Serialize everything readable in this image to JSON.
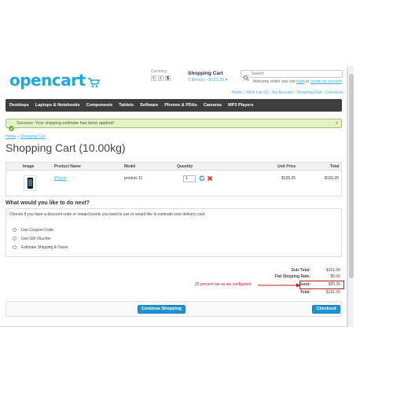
{
  "header": {
    "logo_text": "opencart",
    "currency": {
      "label": "Currency",
      "options": [
        "€",
        "£",
        "$"
      ],
      "selected": "$"
    },
    "cart": {
      "title": "Shopping Cart",
      "summary": "1 item(s) - $131.25 ▾"
    },
    "search": {
      "placeholder": "Search"
    },
    "welcome": {
      "prefix": "Welcome visitor you can ",
      "login": "login",
      "or": " or ",
      "register": "create an account",
      "suffix": "."
    },
    "links": [
      "Home",
      "Wish List (0)",
      "My Account",
      "Shopping Cart",
      "Checkout"
    ]
  },
  "menu": [
    "Desktops",
    "Laptops & Notebooks",
    "Components",
    "Tablets",
    "Software",
    "Phones & PDAs",
    "Cameras",
    "MP3 Players"
  ],
  "alert": {
    "text": "Success: Your shipping estimate has been applied!",
    "close": "x"
  },
  "breadcrumb": {
    "home": "Home",
    "sep": " » ",
    "current": "Shopping Cart"
  },
  "page_title": "Shopping Cart  (10.00kg)",
  "table": {
    "headers": {
      "image": "Image",
      "name": "Product Name",
      "model": "Model",
      "quantity": "Quantity",
      "unit_price": "Unit Price",
      "total": "Total"
    },
    "rows": [
      {
        "name": "iPhone",
        "model": "product 11",
        "quantity": "1",
        "unit_price": "$126.25",
        "total": "$126.25"
      }
    ]
  },
  "next": {
    "title": "What would you like to do next?",
    "desc": "Choose if you have a discount code or reward points you want to use or would like to estimate your delivery cost.",
    "options": [
      "Use Coupon Code",
      "Use Gift Voucher",
      "Estimate Shipping & Taxes"
    ]
  },
  "totals": [
    {
      "label": "Sub-Total:",
      "value": "$101.00"
    },
    {
      "label": "Flat Shipping Rate:",
      "value": "$5.00"
    },
    {
      "label": "Surat:",
      "value": "$25.25"
    },
    {
      "label": "Total:",
      "value": "$131.25"
    }
  ],
  "annotation": "25 percent tax as we configured",
  "buttons": {
    "continue": "Continue Shopping",
    "checkout": "Checkout"
  },
  "colors": {
    "brand": "#22a7d8",
    "link": "#38b0e3",
    "menu_bg": "#3e3e3e",
    "alert_bg": "#e4f1c9",
    "button": "#1d93d1",
    "annotation": "#d0131f"
  }
}
